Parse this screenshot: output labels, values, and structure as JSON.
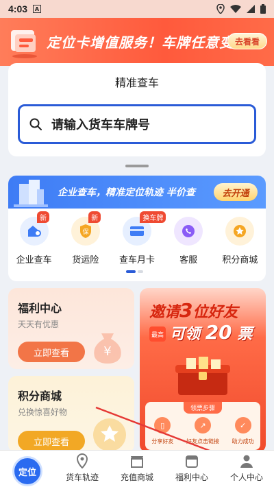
{
  "status_bar": {
    "time": "4:03",
    "notification": "A"
  },
  "top_banner": {
    "text": "定位卡增值服务！车牌任意变！",
    "button": "去看看"
  },
  "search_card": {
    "title": "精准查车",
    "placeholder": "请输入货车车牌号"
  },
  "promo": {
    "text": "企业查车，精准定位轨迹 半价查",
    "button": "去开通"
  },
  "services": [
    {
      "label": "企业查车",
      "badge": "新",
      "icon": "enterprise-locate-icon",
      "color": "#e8f0ff"
    },
    {
      "label": "货运险",
      "badge": "新",
      "icon": "insurance-icon",
      "color": "#fff2d9"
    },
    {
      "label": "查车月卡",
      "badge": "换车牌",
      "icon": "monthly-card-icon",
      "color": "#e6efff"
    },
    {
      "label": "客服",
      "badge": "",
      "icon": "customer-service-icon",
      "color": "#efe6ff"
    },
    {
      "label": "积分商城",
      "badge": "",
      "icon": "points-mall-icon",
      "color": "#fff2d9"
    }
  ],
  "welfare": {
    "title": "福利中心",
    "subtitle": "天天有优惠",
    "button": "立即查看"
  },
  "mall": {
    "title": "积分商城",
    "subtitle": "兑换惊喜好物",
    "button": "立即查看"
  },
  "invite": {
    "line1_prefix": "邀请",
    "line1_num": "3",
    "line1_suffix": "位好友",
    "tag": "最高",
    "line2_prefix": "可领",
    "line2_num": "20",
    "line2_suffix": "票",
    "steps_title": "领票步骤",
    "steps": [
      "分享好友",
      "好友点击链接",
      "助力成功"
    ]
  },
  "bottom_nav": {
    "locate": "定位",
    "items": [
      "货车轨迹",
      "充值商城",
      "福利中心",
      "个人中心"
    ]
  },
  "colors": {
    "primary": "#2a5bd7",
    "accent": "#ff5a3c",
    "arrow": "#e53935"
  }
}
